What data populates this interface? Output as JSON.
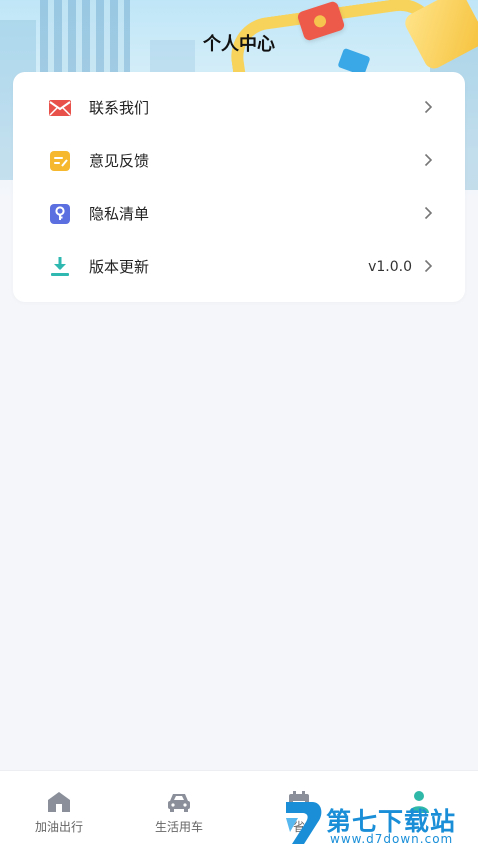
{
  "header": {
    "title": "个人中心"
  },
  "menu": {
    "items": [
      {
        "label": "联系我们",
        "icon": "mail-icon",
        "value": ""
      },
      {
        "label": "意见反馈",
        "icon": "feedback-icon",
        "value": ""
      },
      {
        "label": "隐私清单",
        "icon": "privacy-icon",
        "value": ""
      },
      {
        "label": "版本更新",
        "icon": "download-icon",
        "value": "v1.0.0"
      }
    ]
  },
  "tabbar": {
    "tabs": [
      {
        "label": "加油出行",
        "icon": "home-icon",
        "active": false
      },
      {
        "label": "生活用车",
        "icon": "car-icon",
        "active": false
      },
      {
        "label": "省",
        "icon": "calendar-icon",
        "active": false
      },
      {
        "label": "",
        "icon": "person-icon",
        "active": true
      }
    ]
  },
  "watermark": {
    "name": "第七下载站",
    "url": "www.d7down.com"
  },
  "colors": {
    "background": "#f4f6fa",
    "card": "#ffffff",
    "mail_icon": "#e8514a",
    "feedback_icon": "#f5b82e",
    "privacy_icon": "#5b6fe0",
    "download_icon": "#2fb8b0",
    "tab_icon": "#8a8f99",
    "active_tab_icon": "#2fb8a8",
    "watermark": "#1a8fd8"
  }
}
